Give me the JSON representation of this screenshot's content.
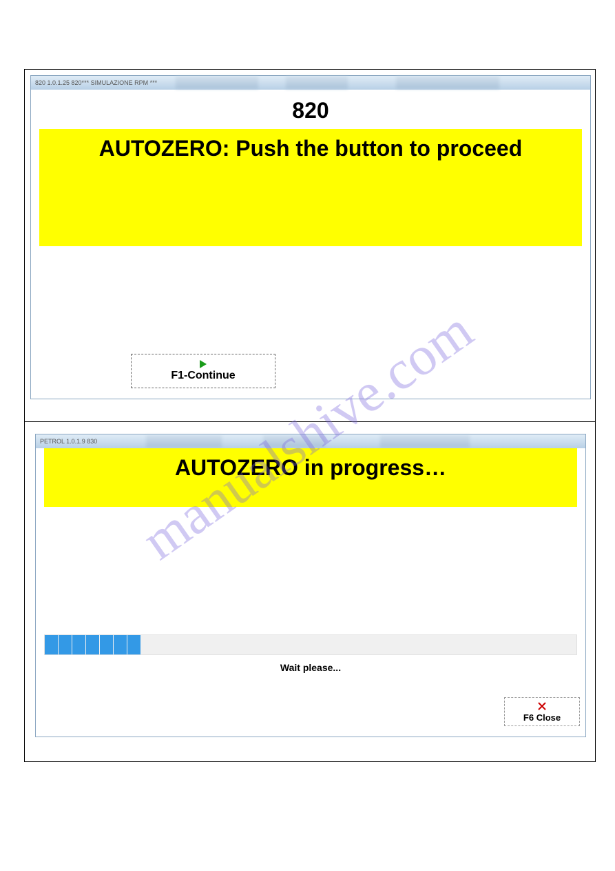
{
  "watermark": "manualshive.com",
  "window1": {
    "title": "820 1.0.1.25 820*** SIMULAZIONE RPM ***",
    "header_number": "820",
    "banner_text": "AUTOZERO: Push the button to proceed",
    "continue_button": "F1-Continue"
  },
  "window2": {
    "title": "PETROL 1.0.1.9  830",
    "banner_text": "AUTOZERO in progress…",
    "wait_text": "Wait please...",
    "close_button": "F6 Close",
    "progress_segments": 7
  }
}
